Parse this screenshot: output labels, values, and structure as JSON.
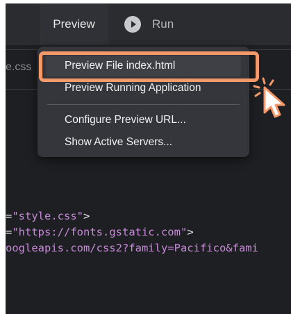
{
  "menubar": {
    "preview_label": "Preview",
    "run_label": "Run"
  },
  "editor_tab": {
    "filename_fragment": "e.css"
  },
  "dropdown": {
    "items": [
      {
        "label": "Preview File index.html"
      },
      {
        "label": "Preview Running Application"
      },
      {
        "label": "Configure Preview URL..."
      },
      {
        "label": "Show Active Servers..."
      }
    ]
  },
  "code_lines": [
    {
      "prefix": "=",
      "value": "\"style.css\"",
      "suffix": ">"
    },
    {
      "prefix": "=",
      "value": "\"https://fonts.gstatic.com\"",
      "suffix": ">"
    },
    {
      "prefix": "",
      "value": "ooglеapis.com/css2?family=Pacifico&fami",
      "suffix": ""
    }
  ],
  "colors": {
    "highlight": "#f4996a",
    "code_string": "#c78ad9",
    "editor_bg": "#1e1f22",
    "menu_bg": "#35363b"
  }
}
